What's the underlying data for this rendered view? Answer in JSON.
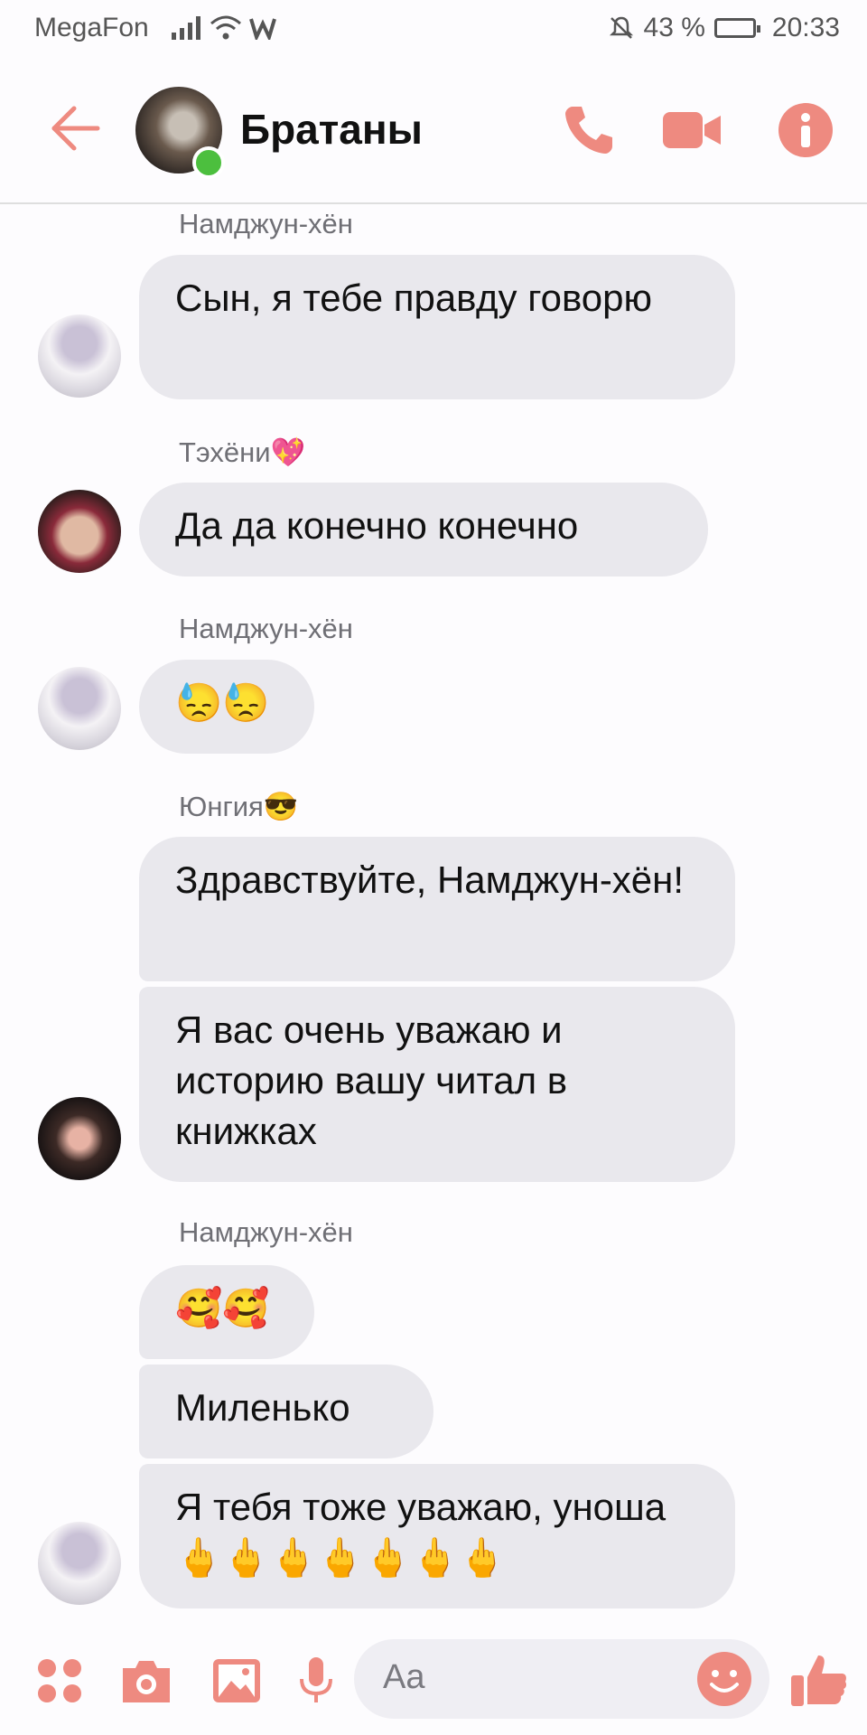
{
  "status": {
    "carrier": "MegaFon",
    "battery": "43 %",
    "time": "20:33"
  },
  "header": {
    "title": "Братаны"
  },
  "messages": [
    {
      "sender": "Намджун-хён",
      "text": "Сын, я тебе правду говорю"
    },
    {
      "sender": "Тэхёни💖",
      "text": "Да да конечно конечно"
    },
    {
      "sender": "Намджун-хён",
      "text": "😓😓"
    },
    {
      "sender": "Юнгия😎",
      "text": "Здравствуйте, Намджун-хён!"
    },
    {
      "text": "Я вас очень уважаю и историю вашу читал в книжках"
    },
    {
      "sender": "Намджун-хён",
      "text": "🥰🥰"
    },
    {
      "text": "Миленько"
    },
    {
      "text": "Я тебя тоже уважаю, уноша 🖕🖕🖕🖕🖕🖕🖕"
    }
  ],
  "composer": {
    "placeholder": "Aa"
  },
  "colors": {
    "accent": "#ee8a80",
    "bubble": "#e9e8ed",
    "online": "#4cbf3e"
  }
}
